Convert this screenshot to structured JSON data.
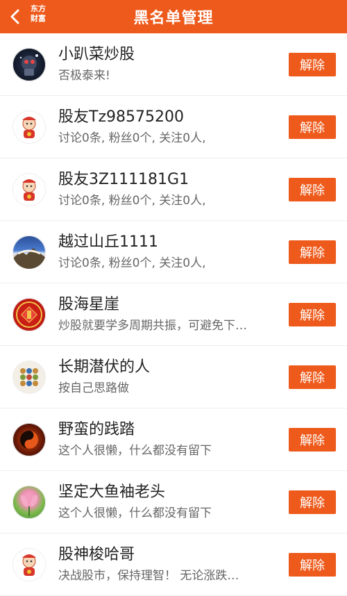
{
  "header": {
    "title": "黑名单管理",
    "brand_line1": "东方",
    "brand_line2": "财富",
    "accent_color": "#ee5a1b"
  },
  "items": [
    {
      "name": "小趴菜炒股",
      "desc": "否极泰来!",
      "avatar": "robot-avatar",
      "action": "解除"
    },
    {
      "name": "股友Tz98575200",
      "desc": "讨论0条, 粉丝0个, 关注0人,",
      "avatar": "mascot-avatar",
      "action": "解除"
    },
    {
      "name": "股友3Z111181G1",
      "desc": "讨论0条, 粉丝0个, 关注0人,",
      "avatar": "mascot-avatar",
      "action": "解除"
    },
    {
      "name": "越过山丘1111",
      "desc": "讨论0条, 粉丝0个, 关注0人,",
      "avatar": "mountain-avatar",
      "action": "解除"
    },
    {
      "name": "股海星崖",
      "desc": "炒股就要学多周期共振，可避免下…",
      "avatar": "fu-avatar",
      "action": "解除"
    },
    {
      "name": "长期潜伏的人",
      "desc": "按自己思路做",
      "avatar": "dots-avatar",
      "action": "解除"
    },
    {
      "name": "野蛮的践踏",
      "desc": "这个人很懒，什么都没有留下",
      "avatar": "taiji-avatar",
      "action": "解除"
    },
    {
      "name": "坚定大鱼袖老头",
      "desc": "这个人很懒，什么都没有留下",
      "avatar": "lotus-avatar",
      "action": "解除"
    },
    {
      "name": "股神梭哈哥",
      "desc": "决战股市，保持理智！ 无论涨跌…",
      "avatar": "mascot-avatar",
      "action": "解除"
    }
  ]
}
